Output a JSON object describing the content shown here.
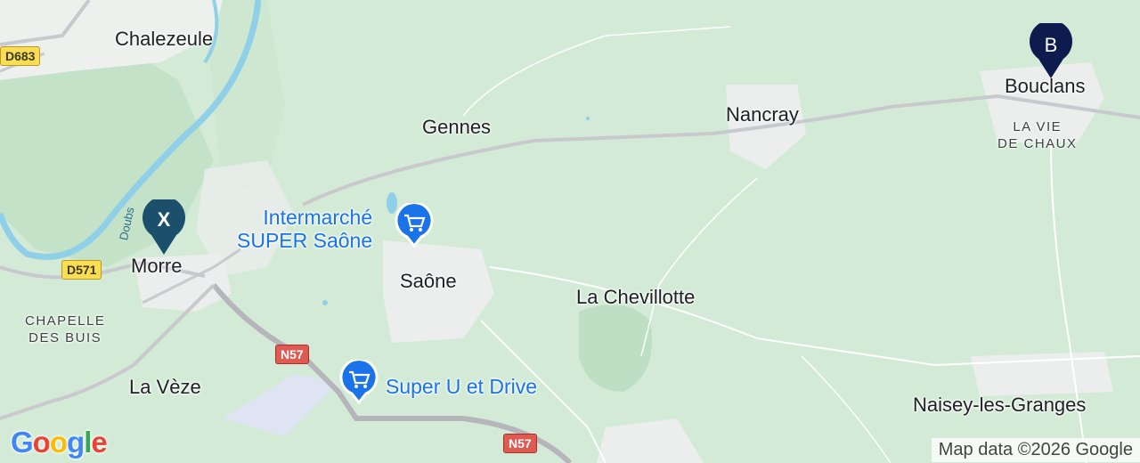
{
  "places": {
    "chalezeule": "Chalezeule",
    "gennes": "Gennes",
    "nancray": "Nancray",
    "bouclans": "Bouclans",
    "la_vie_de_chaux": "LA VIE\nDE CHAUX",
    "morre": "Morre",
    "chapelle_des_buis": "CHAPELLE\nDES BUIS",
    "saone": "Saône",
    "la_chevillotte": "La Chevillotte",
    "la_veze": "La Vèze",
    "naisey": "Naisey-les-Granges"
  },
  "river": {
    "doubs": "Doubs"
  },
  "roads": {
    "d683": "D683",
    "d571": "D571",
    "n57_a": "N57",
    "n57_b": "N57"
  },
  "pois": {
    "intermarche": "Intermarché\nSUPER Saône",
    "superu": "Super U et Drive"
  },
  "markers": {
    "start": "X",
    "end": "B"
  },
  "colors": {
    "start_marker": "#1b4f6b",
    "end_marker": "#0d1b4f",
    "poi": "#1a73e8"
  },
  "footer": {
    "logo": "Google",
    "attribution": "Map data ©2026 Google"
  }
}
